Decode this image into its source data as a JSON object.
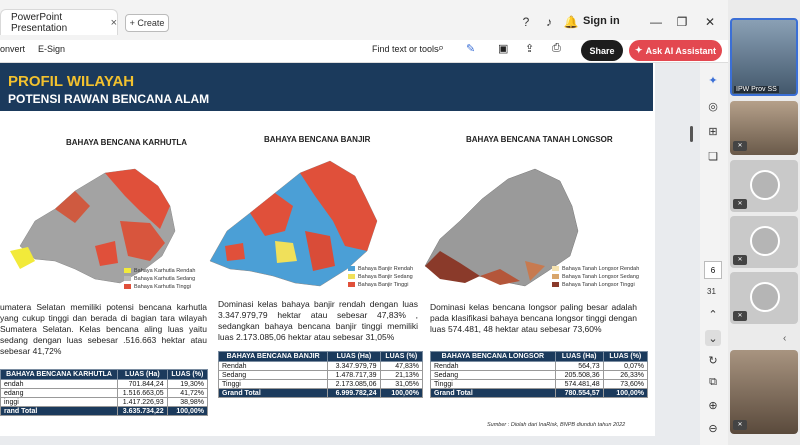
{
  "window": {
    "tab_title": "PowerPoint Presentation",
    "tab_close": "×",
    "new_tab_label": "+ Create",
    "sign_in": "Sign in"
  },
  "toolbar": {
    "convert": "onvert",
    "esign": "E-Sign",
    "find": "Find text or tools",
    "share": "Share",
    "ask_ai": "Ask AI Assistant"
  },
  "slide": {
    "title": "PROFIL WILAYAH",
    "subtitle": "POTENSI RAWAN BENCANA ALAM",
    "maps": [
      {
        "title": "BAHAYA BENCANA KARHUTLA",
        "legend": [
          "Bahaya Karhutla Rendah",
          "Bahaya Karhutla Sedang",
          "Bahaya Karhutla Tinggi"
        ],
        "colors": [
          "#f2ea3a",
          "#b7b7b7",
          "#e0503a"
        ]
      },
      {
        "title": "BAHAYA BENCANA BANJIR",
        "legend": [
          "Bahaya Banjir Rendah",
          "Bahaya Banjir Sedang",
          "Bahaya Banjir Tinggi"
        ],
        "colors": [
          "#4b9fd6",
          "#f0e05a",
          "#e0503a"
        ]
      },
      {
        "title": "BAHAYA BENCANA TANAH LONGSOR",
        "legend": [
          "Bahaya Tanah Longsor Rendah",
          "Bahaya Tanah Longsor Sedang",
          "Bahaya Tanah Longsor Tinggi"
        ],
        "colors": [
          "#f6e3b0",
          "#d8a56a",
          "#8a3a2a"
        ]
      }
    ],
    "paragraphs": [
      "umatera Selatan memiliki potensi bencana karhutla yang cukup tinggi dan berada di bagian tara wilayah Sumatera Selatan. Kelas bencana aling luas yaitu sedang dengan luas sebesar .516.663 hektar atau sebesar 41,72%",
      "Dominasi kelas bahaya banjir rendah dengan luas 3.347.979,79 hektar atau sebesar 47,83% , sedangkan bahaya bencana banjir tinggi memiliki luas 2.173.085,06 hektar atau sebesar 31,05%",
      "Dominasi kelas bencana longsor paling besar adalah pada klasifikasi bahaya bencana longsor tinggi dengan luas 574.481, 48 hektar atau sebesar 73,60%"
    ],
    "tables": [
      {
        "headers": [
          "BAHAYA BENCANA KARHUTLA",
          "LUAS (Ha)",
          "LUAS (%)"
        ],
        "rows": [
          [
            "endah",
            "701.844,24",
            "19,30%"
          ],
          [
            "edang",
            "1.516.663,05",
            "41,72%"
          ],
          [
            "inggi",
            "1.417.226,93",
            "38,98%"
          ]
        ],
        "total": [
          "rand Total",
          "3.635.734,22",
          "100,00%"
        ]
      },
      {
        "headers": [
          "BAHAYA BENCANA BANJIR",
          "LUAS (Ha)",
          "LUAS (%)"
        ],
        "rows": [
          [
            "Rendah",
            "3.347.979,79",
            "47,83%"
          ],
          [
            "Sedang",
            "1.478.717,39",
            "21,13%"
          ],
          [
            "Tinggi",
            "2.173.085,06",
            "31,05%"
          ]
        ],
        "total": [
          "Grand Total",
          "6.999.782,24",
          "100,00%"
        ]
      },
      {
        "headers": [
          "BAHAYA BENCANA LONGSOR",
          "LUAS (Ha)",
          "LUAS (%)"
        ],
        "rows": [
          [
            "Rendah",
            "564,73",
            "0,07%"
          ],
          [
            "Sedang",
            "205.508,36",
            "26,33%"
          ],
          [
            "Tinggi",
            "574.481,48",
            "73,60%"
          ]
        ],
        "total": [
          "Grand Total",
          "780.554,57",
          "100,00%"
        ]
      }
    ],
    "source": "Sumber : Diolah dari InaRisk, BNPB diunduh tahun 2022"
  },
  "viewer": {
    "page_current": "6",
    "page_total": "31"
  },
  "video": {
    "participant_label": "IPW Prov SS",
    "colors": {
      "accent": "#e34850",
      "navy": "#1b3a5c",
      "gold": "#f2c12e"
    }
  }
}
